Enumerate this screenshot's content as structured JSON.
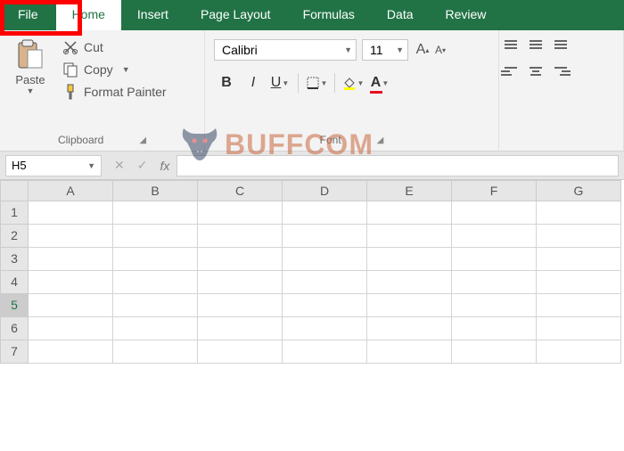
{
  "tabs": {
    "file": "File",
    "home": "Home",
    "insert": "Insert",
    "page_layout": "Page Layout",
    "formulas": "Formulas",
    "data": "Data",
    "review": "Review"
  },
  "clipboard": {
    "paste": "Paste",
    "cut": "Cut",
    "copy": "Copy",
    "format_painter": "Format Painter",
    "group_label": "Clipboard"
  },
  "font": {
    "family": "Calibri",
    "size": "11",
    "increase": "A",
    "decrease": "A",
    "bold": "B",
    "italic": "I",
    "underline": "U",
    "group_label": "Font"
  },
  "formula_bar": {
    "name_box": "H5",
    "cancel": "✕",
    "enter": "✓",
    "fx": "fx",
    "value": ""
  },
  "grid": {
    "columns": [
      "A",
      "B",
      "C",
      "D",
      "E",
      "F",
      "G"
    ],
    "rows": [
      "1",
      "2",
      "3",
      "4",
      "5",
      "6",
      "7"
    ],
    "selected_row": "5"
  },
  "watermark": "BUFFCOM"
}
